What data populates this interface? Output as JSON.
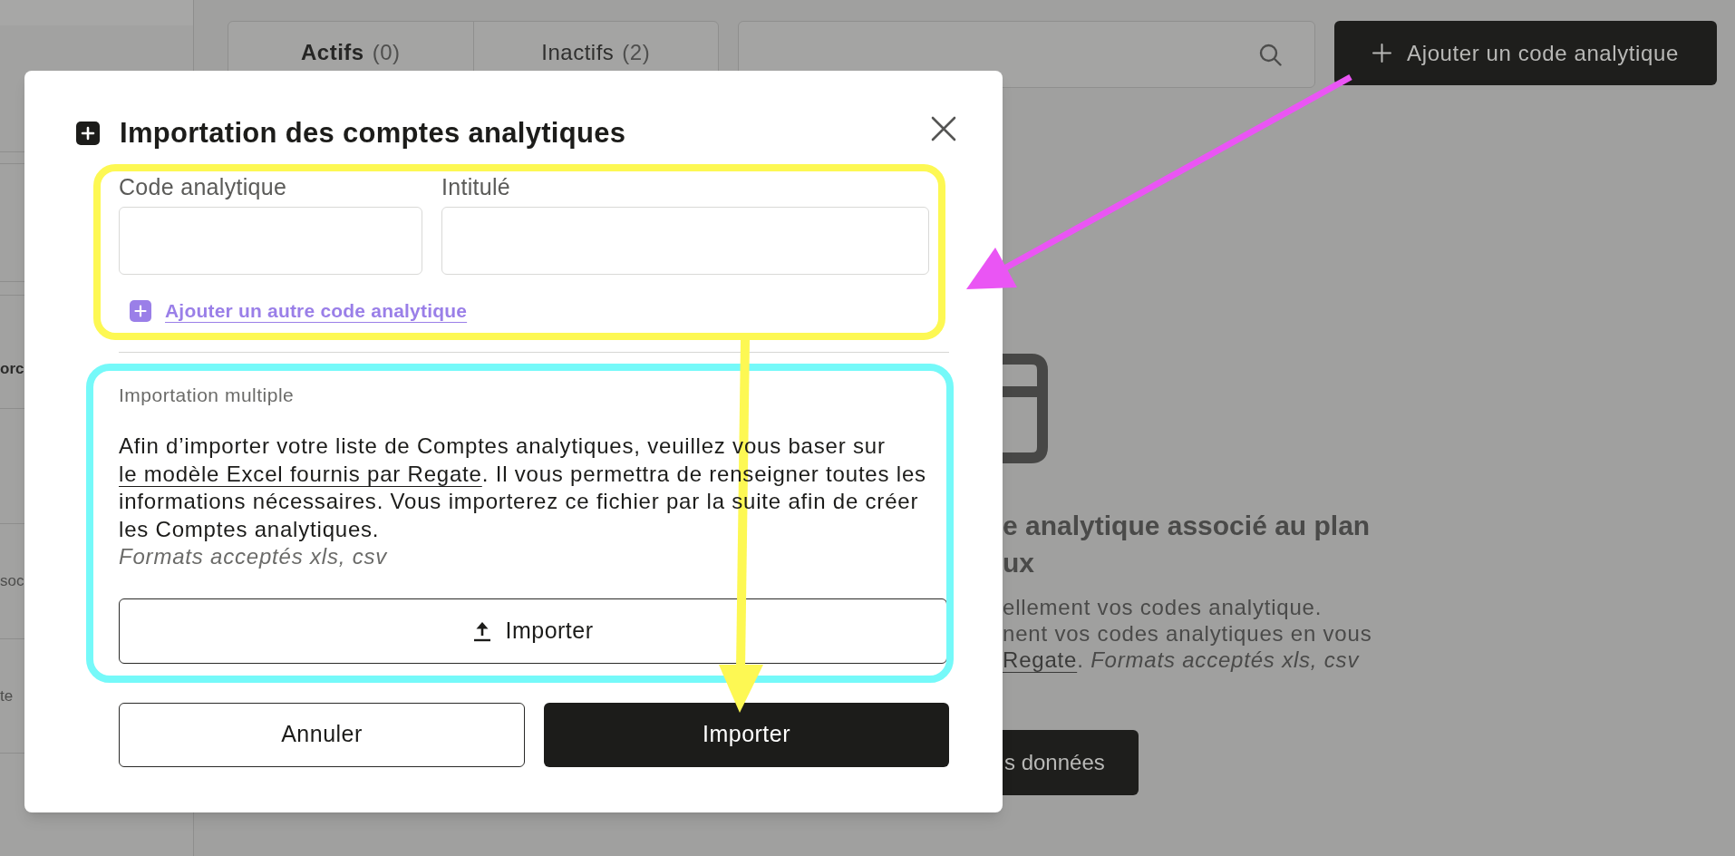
{
  "sidebar": {
    "items": [
      {
        "label": "orc",
        "kind": "heading"
      },
      {
        "label": "soc",
        "kind": "item"
      },
      {
        "label": "te",
        "kind": "item"
      }
    ]
  },
  "tabs": [
    {
      "label": "Actifs",
      "count": "(0)",
      "selected": true
    },
    {
      "label": "Inactifs",
      "count": "(2)",
      "selected": false
    }
  ],
  "header_button": {
    "label": "Ajouter un code analytique"
  },
  "empty_state": {
    "title_lines": [
      "e analytique associé au plan",
      "ux"
    ],
    "description_lines": [
      "ellement vos codes analytique.",
      "nent vos codes analytiques en vous"
    ],
    "link": "Regate",
    "link_tail": ".",
    "formats": "Formats acceptés xls, csv",
    "button": "s données"
  },
  "modal": {
    "title": "Importation des comptes analytiques",
    "fields": [
      {
        "label": "Code analytique"
      },
      {
        "label": "Intitulé"
      }
    ],
    "add_link": "Ajouter un autre code analytique",
    "multiple_import": {
      "heading": "Importation multiple",
      "text_before": "Afin d’importer votre liste de Comptes analytiques, veuillez vous baser sur",
      "link": "le modèle Excel fournis par Regate",
      "text_after_lines": [
        ". Il vous permettra de renseigner toutes les",
        "informations nécessaires. Vous importerez ce fichier par la suite afin de créer",
        "les Comptes analytiques."
      ],
      "formats": "Formats acceptés xls, csv",
      "button": "Importer"
    },
    "buttons": [
      {
        "label": "Annuler",
        "kind": "secondary"
      },
      {
        "label": "Importer",
        "kind": "primary"
      }
    ]
  }
}
